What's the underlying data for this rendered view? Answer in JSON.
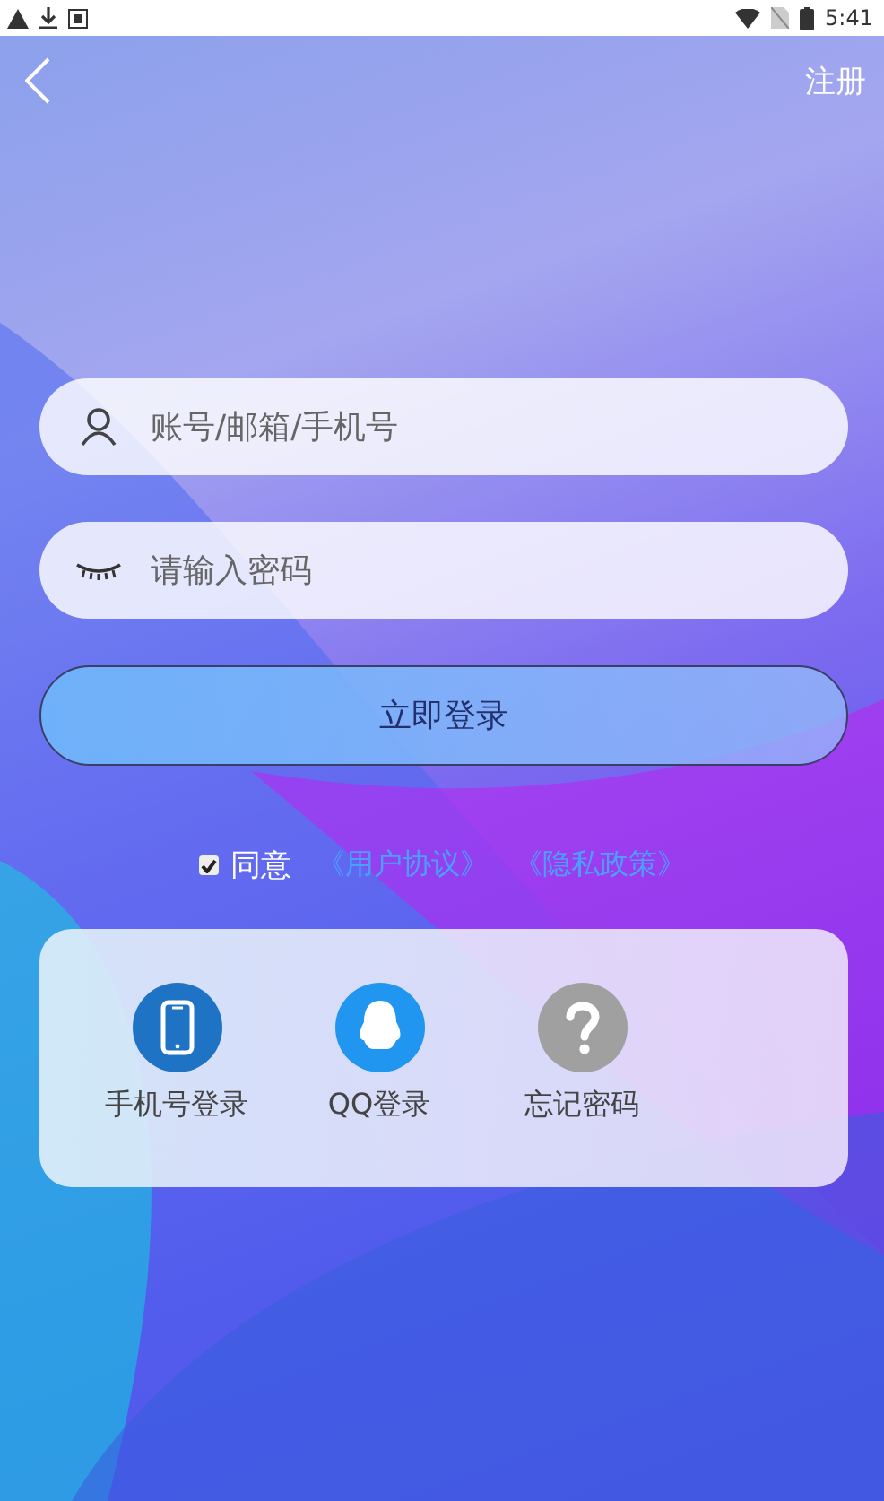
{
  "status_bar": {
    "time": "5:41"
  },
  "nav": {
    "action": "注册"
  },
  "fields": [
    {
      "kind": "user",
      "placeholder": "账号/邮箱/手机号"
    },
    {
      "kind": "password",
      "placeholder": "请输入密码"
    }
  ],
  "login_button": "立即登录",
  "agreement": {
    "checked": true,
    "label": "同意",
    "links": [
      "《用户协议》",
      "《隐私政策》"
    ]
  },
  "options": [
    {
      "kind": "phone",
      "label": "手机号登录",
      "color": "#1f73c4"
    },
    {
      "kind": "qq",
      "label": "QQ登录",
      "color": "#2196f0"
    },
    {
      "kind": "help",
      "label": "忘记密码",
      "color": "#a0a0a0"
    }
  ]
}
